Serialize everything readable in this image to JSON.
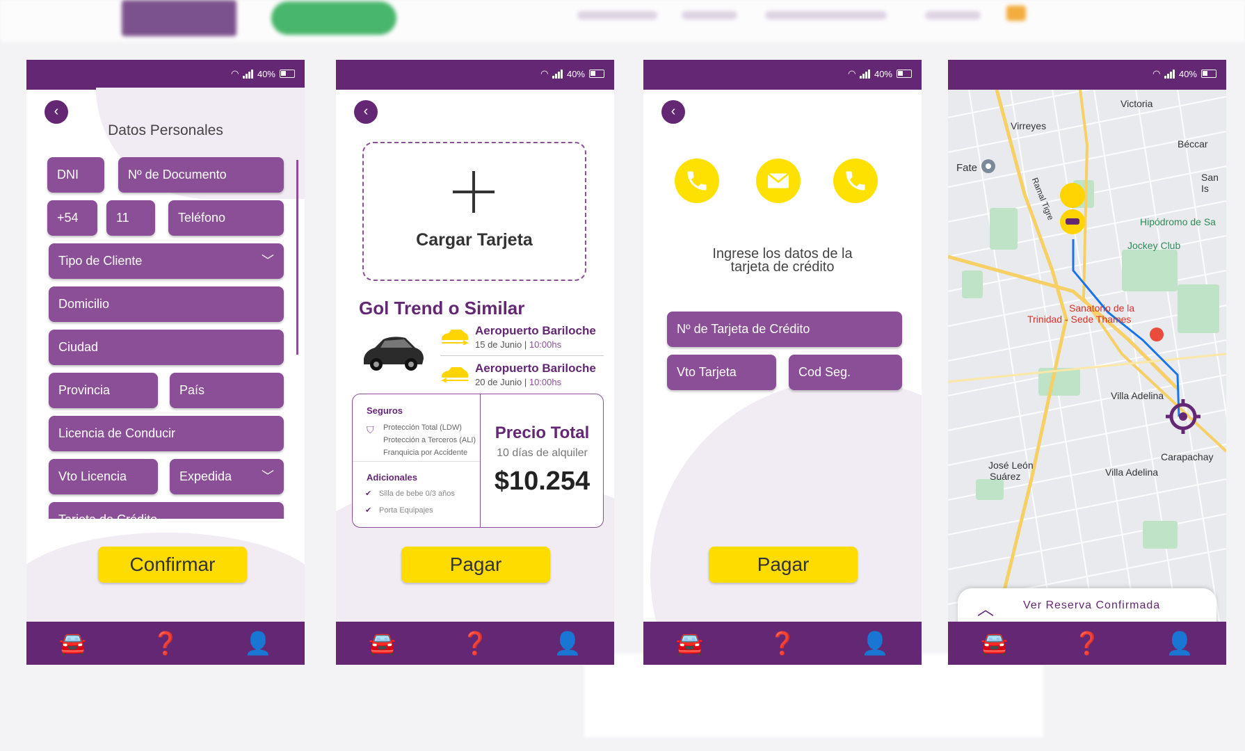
{
  "status": {
    "battery": "40%"
  },
  "nav_icons": [
    "cars-icon",
    "help-icon",
    "user-lock-icon"
  ],
  "phone1": {
    "title": "Datos Personales",
    "fields": {
      "dni": "DNI",
      "documento": "Nº de Documento",
      "codigo_pais": "+54",
      "codigo_area": "11",
      "telefono": "Teléfono",
      "tipo_cliente": "Tipo de Cliente",
      "domicilio": "Domicilio",
      "ciudad": "Ciudad",
      "provincia": "Provincia",
      "pais": "País",
      "licencia": "Licencia de Conducir",
      "vto_licencia": "Vto Licencia",
      "expedida": "Expedida",
      "tarjeta": "Tarjeta de Crédito"
    },
    "button": "Confirmar"
  },
  "phone2": {
    "upload_label": "Cargar Tarjeta",
    "car_title": "Gol Trend o Similar",
    "pickup": {
      "place": "Aeropuerto Bariloche",
      "date": "15 de Junio |",
      "time": "10:00hs"
    },
    "return": {
      "place": "Aeropuerto Bariloche",
      "date": "20 de Junio |",
      "time": "10:00hs"
    },
    "seguros_title": "Seguros",
    "seguros": [
      "Protección Total (LDW)",
      "Protección a Terceros (ALI)",
      "Franquicia por Accidente"
    ],
    "adicionales_title": "Adicionales",
    "adicionales": [
      "Silla de bebe 0/3 años",
      "Porta Equipajes"
    ],
    "price_label": "Precio Total",
    "price_days": "10 días de alquiler",
    "price_value": "$10.254",
    "button": "Pagar"
  },
  "phone3": {
    "instruction_line1": "Ingrese los datos de la",
    "instruction_line2": "tarjeta de crédito",
    "card_number": "Nº de Tarjeta de Crédito",
    "expiry": "Vto Tarjeta",
    "cvv": "Cod Seg.",
    "button": "Pagar",
    "contact_icons": [
      "phone-icon",
      "mail-icon",
      "whatsapp-icon"
    ]
  },
  "phone4": {
    "map_labels": {
      "victoria": "Victoria",
      "virreyes": "Virreyes",
      "beccar": "Béccar",
      "fate": "Fate",
      "san_is": "San Is",
      "hipodromo": "Hipódromo de Sa",
      "jockey": "Jockey Club",
      "sanatorio1": "Sanatorio de la",
      "sanatorio2": "Trinidad - Sede Thames",
      "villa_adelina": "Villa Adelina",
      "villa_adelina2": "Villa Adelina",
      "carapachay": "Carapachay",
      "jose_leon1": "José León",
      "jose_leon2": "Suárez",
      "ramal_tigre": "Ramal Tigre"
    },
    "sheet_label": "Ver Reserva Confirmada"
  }
}
